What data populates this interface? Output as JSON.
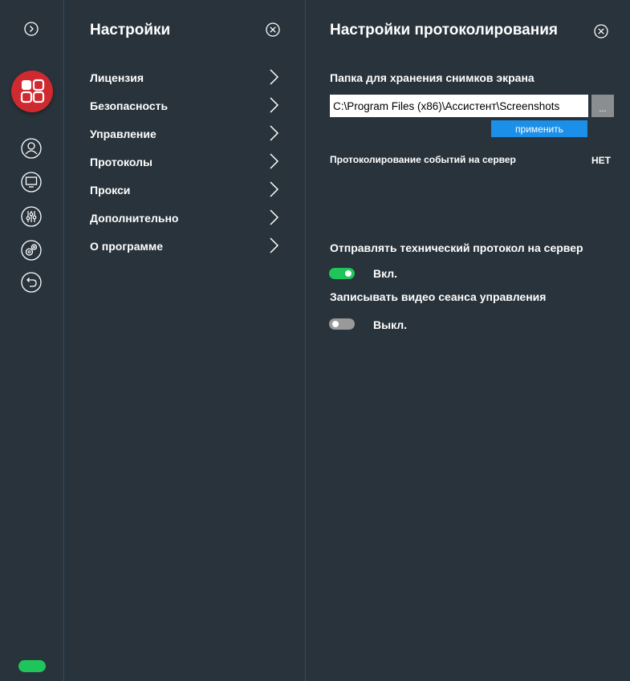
{
  "colors": {
    "background": "#28333b",
    "accent": "#1c8fe8",
    "toggle_on": "#1fc55b",
    "toggle_off": "#999999",
    "logo": "#cf2a30"
  },
  "rail": {
    "icons": [
      "expand-icon",
      "app-logo-icon",
      "user-icon",
      "monitor-icon",
      "equalizer-icon",
      "gears-icon",
      "back-icon"
    ],
    "status": "online"
  },
  "settings_menu": {
    "title": "Настройки",
    "items": [
      {
        "label": "Лицензия"
      },
      {
        "label": "Безопасность"
      },
      {
        "label": "Управление"
      },
      {
        "label": "Протоколы"
      },
      {
        "label": "Прокси"
      },
      {
        "label": "Дополнительно"
      },
      {
        "label": "О программе"
      }
    ]
  },
  "logging_panel": {
    "title": "Настройки протоколирования",
    "screenshots_folder": {
      "label": "Папка для хранения снимков экрана",
      "value": "C:\\Program Files (x86)\\Ассистент\\Screenshots",
      "browse_label": "...",
      "apply_label": "применить"
    },
    "server_event_logging": {
      "label": "Протоколирование событий на сервер",
      "value": "НЕТ"
    },
    "send_tech_log": {
      "label": "Отправлять технический протокол на сервер",
      "state": "Вкл.",
      "on": true
    },
    "record_video": {
      "label": "Записывать видео сеанса управления",
      "state": "Выкл.",
      "on": false
    }
  }
}
